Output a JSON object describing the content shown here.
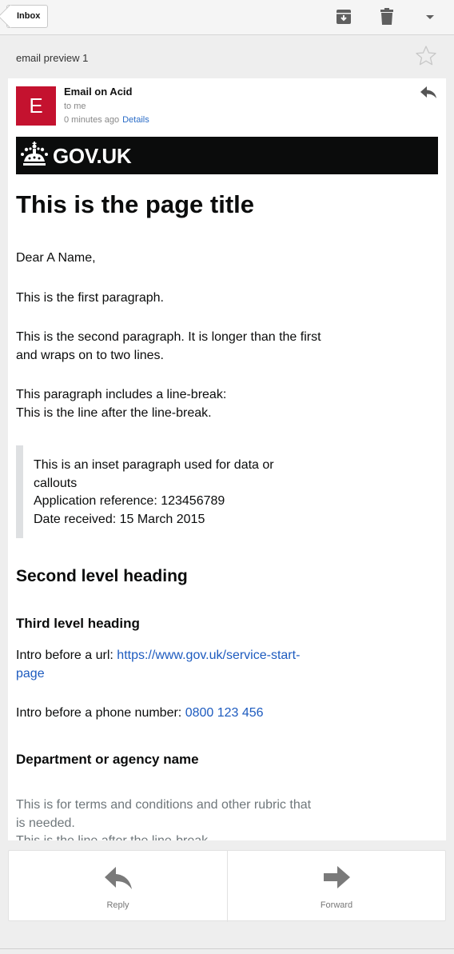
{
  "toolbar": {
    "back_label": "Inbox",
    "icons": [
      "archive-icon",
      "trash-icon",
      "chevron-down-icon"
    ]
  },
  "subject": "email preview 1",
  "message": {
    "avatar_letter": "E",
    "sender": "Email on Acid",
    "recipient": "to me",
    "time": "0 minutes ago",
    "details_link": "Details"
  },
  "email": {
    "brand": "GOV.UK",
    "title": "This is the page title",
    "greeting": "Dear A Name,",
    "para1": "This is the first paragraph.",
    "para2": "This is the second paragraph. It is longer than the first and wraps on to two lines.",
    "para3_line1": "This paragraph includes a line-break:",
    "para3_line2": "This is the line after the line-break.",
    "inset_line1": "This is an inset paragraph used for data or callouts",
    "inset_line2": "Application reference: 123456789",
    "inset_line3": "Date received: 15 March 2015",
    "h2": "Second level heading",
    "h3": "Third level heading",
    "url_intro": "Intro before a url: ",
    "url": "https://www.gov.uk/service-start-page",
    "phone_intro": "Intro before a phone number: ",
    "phone": "0800 123 456",
    "department": "Department or agency name",
    "rubric1": "This is for terms and conditions and other rubric that is needed.",
    "rubric2": "This is the line after the line-break."
  },
  "actions": {
    "reply_label": "Reply",
    "forward_label": "Forward"
  },
  "colors": {
    "avatar": "#c4122f",
    "gov_banner": "#0b0c0c",
    "link": "#1d5bbf",
    "rubric": "#6f777b"
  }
}
